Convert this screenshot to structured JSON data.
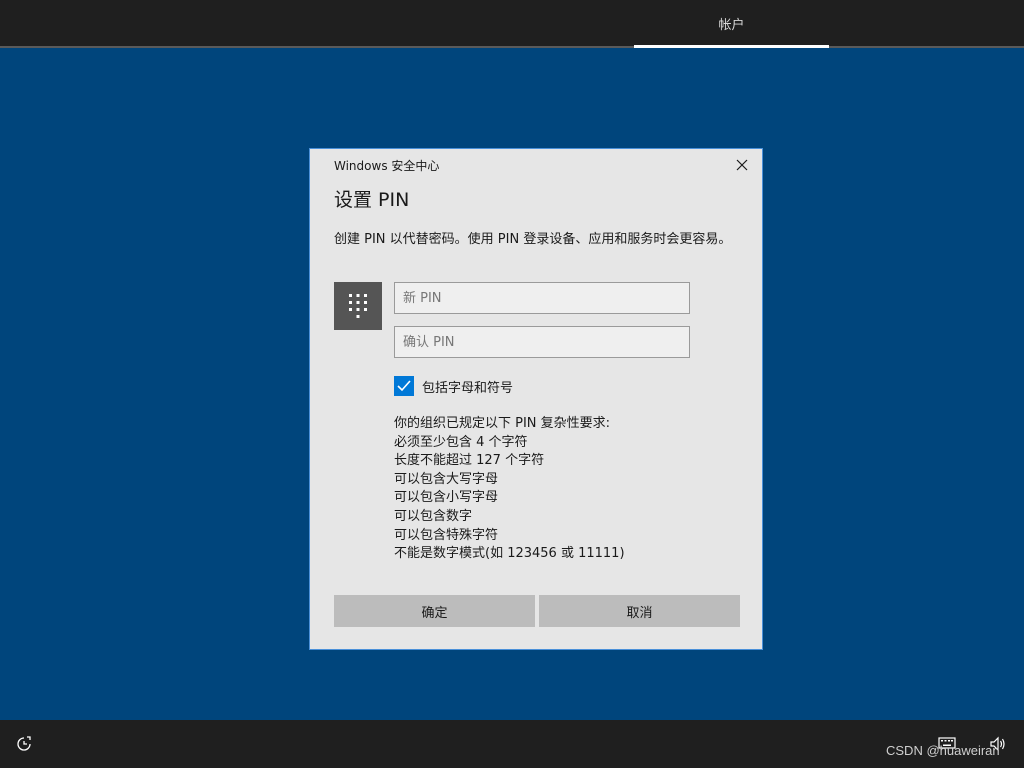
{
  "top_tab": {
    "label": "帐户"
  },
  "dialog": {
    "app_title": "Windows 安全中心",
    "heading": "设置 PIN",
    "description": "创建 PIN 以代替密码。使用 PIN 登录设备、应用和服务时会更容易。",
    "new_pin_placeholder": "新 PIN",
    "confirm_pin_placeholder": "确认 PIN",
    "checkbox": {
      "label": "包括字母和符号",
      "checked": true
    },
    "requirements": [
      "你的组织已规定以下 PIN 复杂性要求:",
      "必须至少包含 4 个字符",
      "长度不能超过 127 个字符",
      "可以包含大写字母",
      "可以包含小写字母",
      "可以包含数字",
      "可以包含特殊字符",
      "不能是数字模式(如 123456 或 11111)"
    ],
    "ok_label": "确定",
    "cancel_label": "取消"
  },
  "icons": {
    "close": "close-icon",
    "pin_tile": "keypad-icon",
    "ease_of_access": "ease-of-access-icon",
    "keyboard": "keyboard-icon",
    "volume": "volume-icon"
  },
  "watermark": "CSDN @huaweiran",
  "colors": {
    "background": "#00457c",
    "accent": "#0078d7",
    "dialog_bg": "#e6e6e6",
    "bar_bg": "#1f1f1f"
  }
}
